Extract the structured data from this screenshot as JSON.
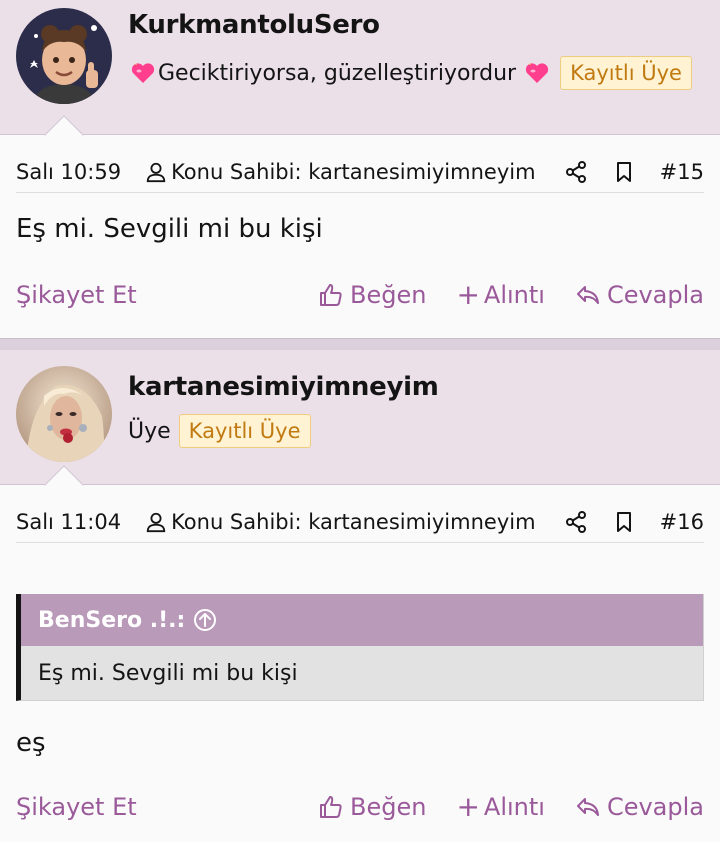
{
  "colors": {
    "header_bg": "#ebdfe8",
    "accent": "#9a5a9a",
    "badge_bg": "#fff3d4",
    "badge_text": "#c07a10",
    "quote_head_bg": "#b99ab9"
  },
  "posts": [
    {
      "username": "KurkmantoluSero",
      "user_title": "Geciktiriyorsa, güzelleştiriyordur",
      "title_icons": [
        "heart-icon",
        "heart-icon"
      ],
      "badge": "Kayıtlı Üye",
      "avatar_icon": "memoji-avatar",
      "time": "Salı 10:59",
      "op_label": "Konu Sahibi: kartanesimiyimneyim",
      "post_number": "#15",
      "body": "Eş mi. Sevgili mi bu kişi",
      "actions": {
        "report": "Şikayet Et",
        "like": "Beğen",
        "quote": "Alıntı",
        "reply": "Cevapla"
      }
    },
    {
      "username": "kartanesimiyimneyim",
      "user_title": "Üye",
      "badge": "Kayıtlı Üye",
      "avatar_icon": "photo-avatar",
      "time": "Salı 11:04",
      "op_label": "Konu Sahibi: kartanesimiyimneyim",
      "post_number": "#16",
      "quote": {
        "author": "BenSero .!.:",
        "text": "Eş mi. Sevgili mi bu kişi"
      },
      "body": "eş",
      "actions": {
        "report": "Şikayet Et",
        "like": "Beğen",
        "quote": "Alıntı",
        "reply": "Cevapla"
      }
    }
  ]
}
